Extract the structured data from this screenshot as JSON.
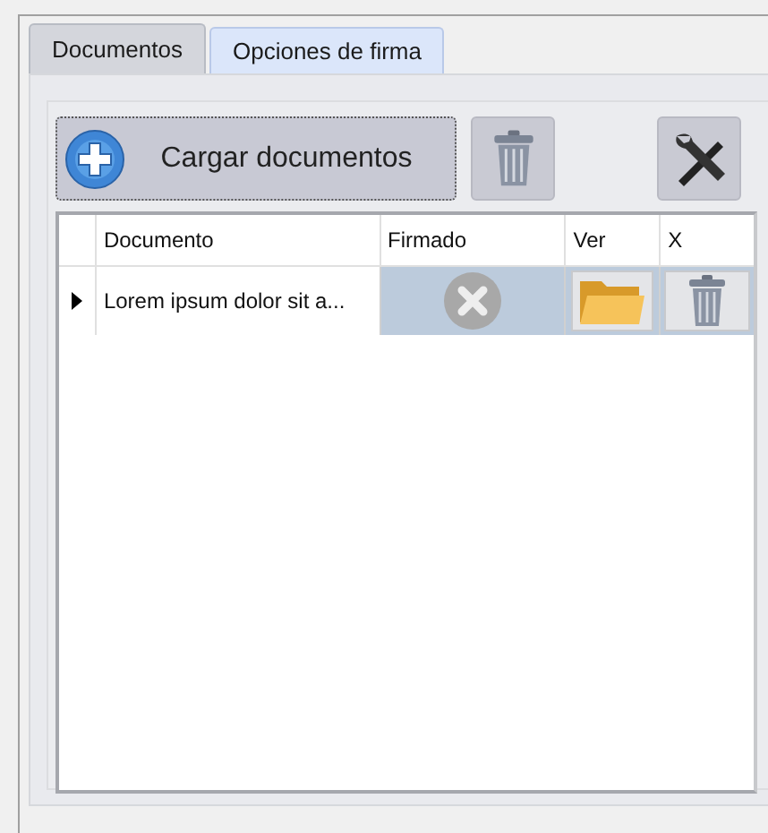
{
  "tabs": [
    {
      "label": "Documentos",
      "selected": true
    },
    {
      "label": "Opciones de firma",
      "selected": false
    }
  ],
  "toolbar": {
    "load_button": "Cargar documentos"
  },
  "table": {
    "columns": [
      "Documento",
      "Firmado",
      "Ver",
      "X"
    ],
    "rows": [
      {
        "document": "Lorem ipsum dolor sit a...",
        "signed": false,
        "selected": true
      }
    ]
  }
}
